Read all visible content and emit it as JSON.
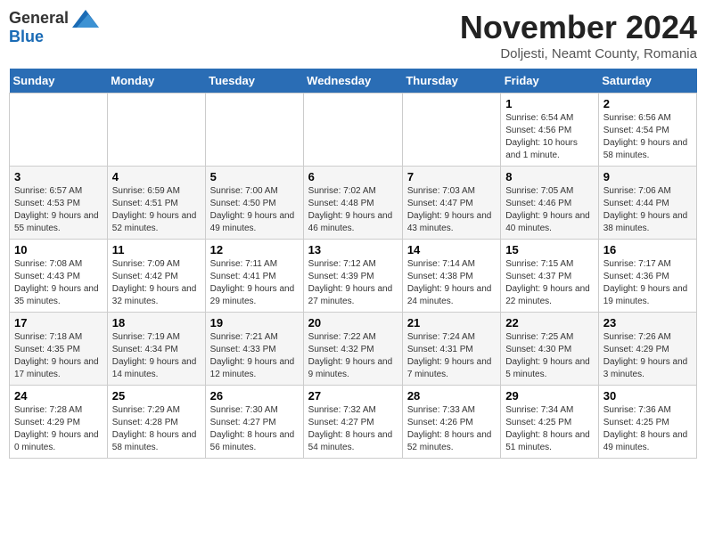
{
  "logo": {
    "general": "General",
    "blue": "Blue"
  },
  "title": "November 2024",
  "subtitle": "Doljesti, Neamt County, Romania",
  "days_header": [
    "Sunday",
    "Monday",
    "Tuesday",
    "Wednesday",
    "Thursday",
    "Friday",
    "Saturday"
  ],
  "weeks": [
    [
      {
        "day": "",
        "info": ""
      },
      {
        "day": "",
        "info": ""
      },
      {
        "day": "",
        "info": ""
      },
      {
        "day": "",
        "info": ""
      },
      {
        "day": "",
        "info": ""
      },
      {
        "day": "1",
        "info": "Sunrise: 6:54 AM\nSunset: 4:56 PM\nDaylight: 10 hours and 1 minute."
      },
      {
        "day": "2",
        "info": "Sunrise: 6:56 AM\nSunset: 4:54 PM\nDaylight: 9 hours and 58 minutes."
      }
    ],
    [
      {
        "day": "3",
        "info": "Sunrise: 6:57 AM\nSunset: 4:53 PM\nDaylight: 9 hours and 55 minutes."
      },
      {
        "day": "4",
        "info": "Sunrise: 6:59 AM\nSunset: 4:51 PM\nDaylight: 9 hours and 52 minutes."
      },
      {
        "day": "5",
        "info": "Sunrise: 7:00 AM\nSunset: 4:50 PM\nDaylight: 9 hours and 49 minutes."
      },
      {
        "day": "6",
        "info": "Sunrise: 7:02 AM\nSunset: 4:48 PM\nDaylight: 9 hours and 46 minutes."
      },
      {
        "day": "7",
        "info": "Sunrise: 7:03 AM\nSunset: 4:47 PM\nDaylight: 9 hours and 43 minutes."
      },
      {
        "day": "8",
        "info": "Sunrise: 7:05 AM\nSunset: 4:46 PM\nDaylight: 9 hours and 40 minutes."
      },
      {
        "day": "9",
        "info": "Sunrise: 7:06 AM\nSunset: 4:44 PM\nDaylight: 9 hours and 38 minutes."
      }
    ],
    [
      {
        "day": "10",
        "info": "Sunrise: 7:08 AM\nSunset: 4:43 PM\nDaylight: 9 hours and 35 minutes."
      },
      {
        "day": "11",
        "info": "Sunrise: 7:09 AM\nSunset: 4:42 PM\nDaylight: 9 hours and 32 minutes."
      },
      {
        "day": "12",
        "info": "Sunrise: 7:11 AM\nSunset: 4:41 PM\nDaylight: 9 hours and 29 minutes."
      },
      {
        "day": "13",
        "info": "Sunrise: 7:12 AM\nSunset: 4:39 PM\nDaylight: 9 hours and 27 minutes."
      },
      {
        "day": "14",
        "info": "Sunrise: 7:14 AM\nSunset: 4:38 PM\nDaylight: 9 hours and 24 minutes."
      },
      {
        "day": "15",
        "info": "Sunrise: 7:15 AM\nSunset: 4:37 PM\nDaylight: 9 hours and 22 minutes."
      },
      {
        "day": "16",
        "info": "Sunrise: 7:17 AM\nSunset: 4:36 PM\nDaylight: 9 hours and 19 minutes."
      }
    ],
    [
      {
        "day": "17",
        "info": "Sunrise: 7:18 AM\nSunset: 4:35 PM\nDaylight: 9 hours and 17 minutes."
      },
      {
        "day": "18",
        "info": "Sunrise: 7:19 AM\nSunset: 4:34 PM\nDaylight: 9 hours and 14 minutes."
      },
      {
        "day": "19",
        "info": "Sunrise: 7:21 AM\nSunset: 4:33 PM\nDaylight: 9 hours and 12 minutes."
      },
      {
        "day": "20",
        "info": "Sunrise: 7:22 AM\nSunset: 4:32 PM\nDaylight: 9 hours and 9 minutes."
      },
      {
        "day": "21",
        "info": "Sunrise: 7:24 AM\nSunset: 4:31 PM\nDaylight: 9 hours and 7 minutes."
      },
      {
        "day": "22",
        "info": "Sunrise: 7:25 AM\nSunset: 4:30 PM\nDaylight: 9 hours and 5 minutes."
      },
      {
        "day": "23",
        "info": "Sunrise: 7:26 AM\nSunset: 4:29 PM\nDaylight: 9 hours and 3 minutes."
      }
    ],
    [
      {
        "day": "24",
        "info": "Sunrise: 7:28 AM\nSunset: 4:29 PM\nDaylight: 9 hours and 0 minutes."
      },
      {
        "day": "25",
        "info": "Sunrise: 7:29 AM\nSunset: 4:28 PM\nDaylight: 8 hours and 58 minutes."
      },
      {
        "day": "26",
        "info": "Sunrise: 7:30 AM\nSunset: 4:27 PM\nDaylight: 8 hours and 56 minutes."
      },
      {
        "day": "27",
        "info": "Sunrise: 7:32 AM\nSunset: 4:27 PM\nDaylight: 8 hours and 54 minutes."
      },
      {
        "day": "28",
        "info": "Sunrise: 7:33 AM\nSunset: 4:26 PM\nDaylight: 8 hours and 52 minutes."
      },
      {
        "day": "29",
        "info": "Sunrise: 7:34 AM\nSunset: 4:25 PM\nDaylight: 8 hours and 51 minutes."
      },
      {
        "day": "30",
        "info": "Sunrise: 7:36 AM\nSunset: 4:25 PM\nDaylight: 8 hours and 49 minutes."
      }
    ]
  ]
}
